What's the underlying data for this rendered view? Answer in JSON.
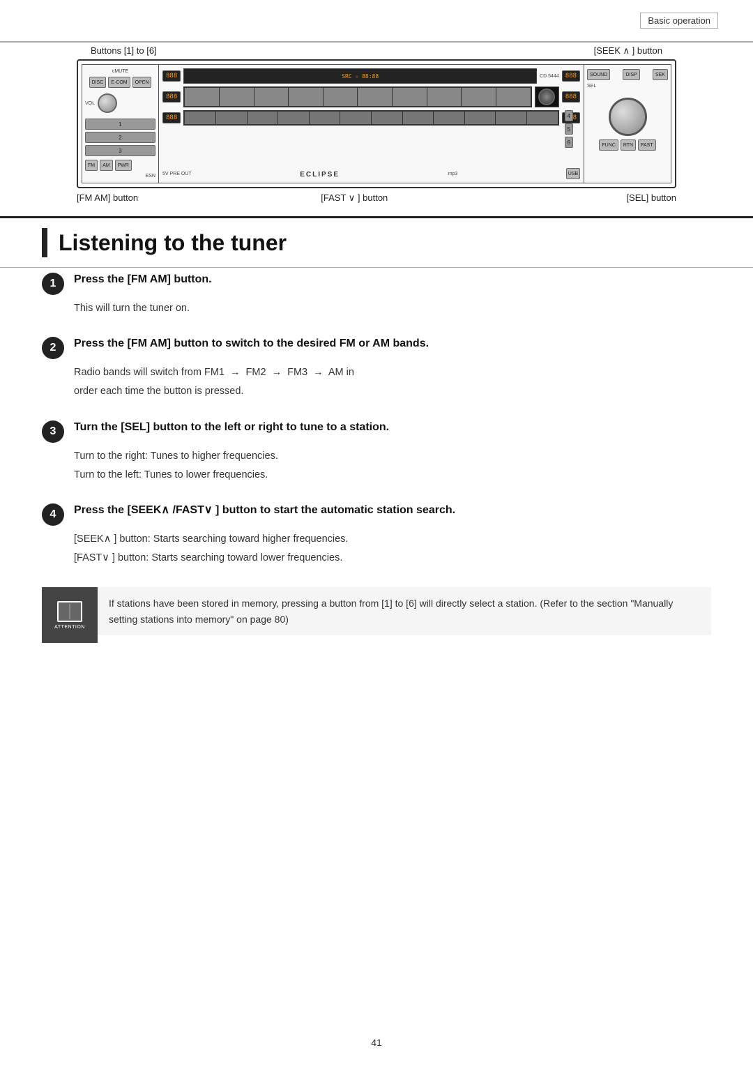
{
  "header": {
    "section_label": "Basic operation"
  },
  "diagram": {
    "top_label_left": "Buttons [1] to [6]",
    "top_label_right": "[SEEK ∧ ] button",
    "bottom_label_left": "[FM AM] button",
    "bottom_label_mid": "[FAST ∨ ] button",
    "bottom_label_right": "[SEL] button",
    "device_brand": "ECLIPSE"
  },
  "section": {
    "title": "Listening to the tuner"
  },
  "steps": [
    {
      "number": "1",
      "title": "Press the [FM AM] button.",
      "body_lines": [
        "This will turn the tuner on."
      ]
    },
    {
      "number": "2",
      "title": "Press the [FM AM] button to switch to the desired FM or AM bands.",
      "body_lines": [
        "Radio bands will switch from FM1 → FM2 → FM3 → AM in",
        "order each time the button is pressed."
      ]
    },
    {
      "number": "3",
      "title": "Turn the [SEL] button to the left or right to tune to a station.",
      "body_lines": [
        "Turn to the right:   Tunes to higher frequencies.",
        "Turn to the left:    Tunes to lower frequencies."
      ]
    },
    {
      "number": "4",
      "title": "Press the [SEEK∧ /FAST∨ ] button to start the automatic station search.",
      "body_lines": [
        "[SEEK∧ ] button:  Starts searching toward higher frequencies.",
        "[FAST∨ ] button:  Starts searching toward lower frequencies."
      ]
    }
  ],
  "attention": {
    "icon_label": "ATTENTION",
    "text": "If stations have been stored in memory, pressing a button from [1] to [6] will directly select a station. (Refer to the section \"Manually setting stations into memory\" on page 80)"
  },
  "page_number": "41"
}
